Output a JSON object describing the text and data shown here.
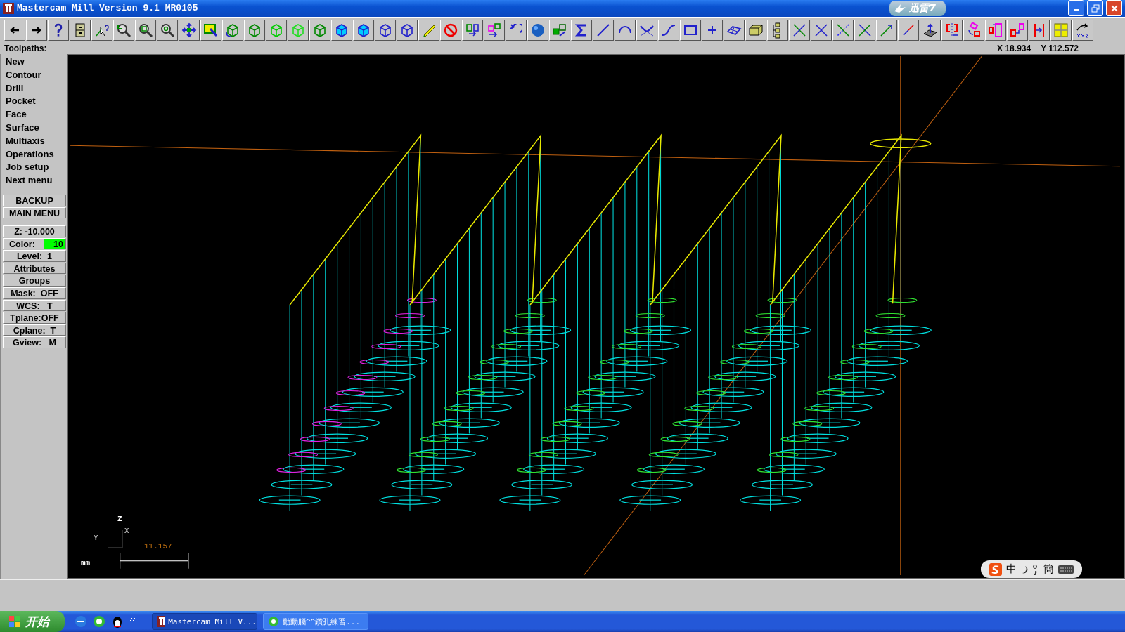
{
  "window": {
    "title": "Mastercam Mill Version 9.1 MR0105"
  },
  "floating_widget": {
    "label": "迅雷7"
  },
  "prompt": {
    "label": "Toolpaths:"
  },
  "coordinates": {
    "x": "X 18.934",
    "y": "Y 112.572"
  },
  "menu": {
    "items": [
      {
        "label": "New"
      },
      {
        "label": "Contour"
      },
      {
        "label": "Drill"
      },
      {
        "label": "Pocket"
      },
      {
        "label": "Face"
      },
      {
        "label": "Surface"
      },
      {
        "label": "Multiaxis"
      },
      {
        "label": "Operations"
      },
      {
        "label": "Job setup"
      },
      {
        "label": "Next menu"
      }
    ]
  },
  "buttons": [
    "BACKUP",
    "MAIN MENU"
  ],
  "settings": [
    {
      "kind": "text",
      "label": "Z: -10.000"
    },
    {
      "kind": "color",
      "label": "Color:",
      "value": "10",
      "color": "#00ff00"
    },
    {
      "kind": "text",
      "label": "Level:  1"
    },
    {
      "kind": "text",
      "label": "Attributes"
    },
    {
      "kind": "text",
      "label": "Groups"
    },
    {
      "kind": "text",
      "label": "Mask:  OFF"
    },
    {
      "kind": "text",
      "label": "WCS:   T"
    },
    {
      "kind": "text",
      "label": "Tplane:OFF"
    },
    {
      "kind": "text",
      "label": "Cplane:  T"
    },
    {
      "kind": "text",
      "label": "Gview:   M"
    }
  ],
  "viewport": {
    "axis_labels": {
      "z": "Z",
      "y": "Y",
      "x": "X"
    },
    "scale_value": "11.157",
    "units": "mm"
  },
  "ime_bar": {
    "items": [
      "中",
      "簡"
    ]
  },
  "taskbar": {
    "start": "开始",
    "tasks": [
      {
        "label": "Mastercam Mill V...",
        "selected": true
      },
      {
        "label": "動動腦^^鑽孔練習...",
        "selected": false
      }
    ]
  }
}
